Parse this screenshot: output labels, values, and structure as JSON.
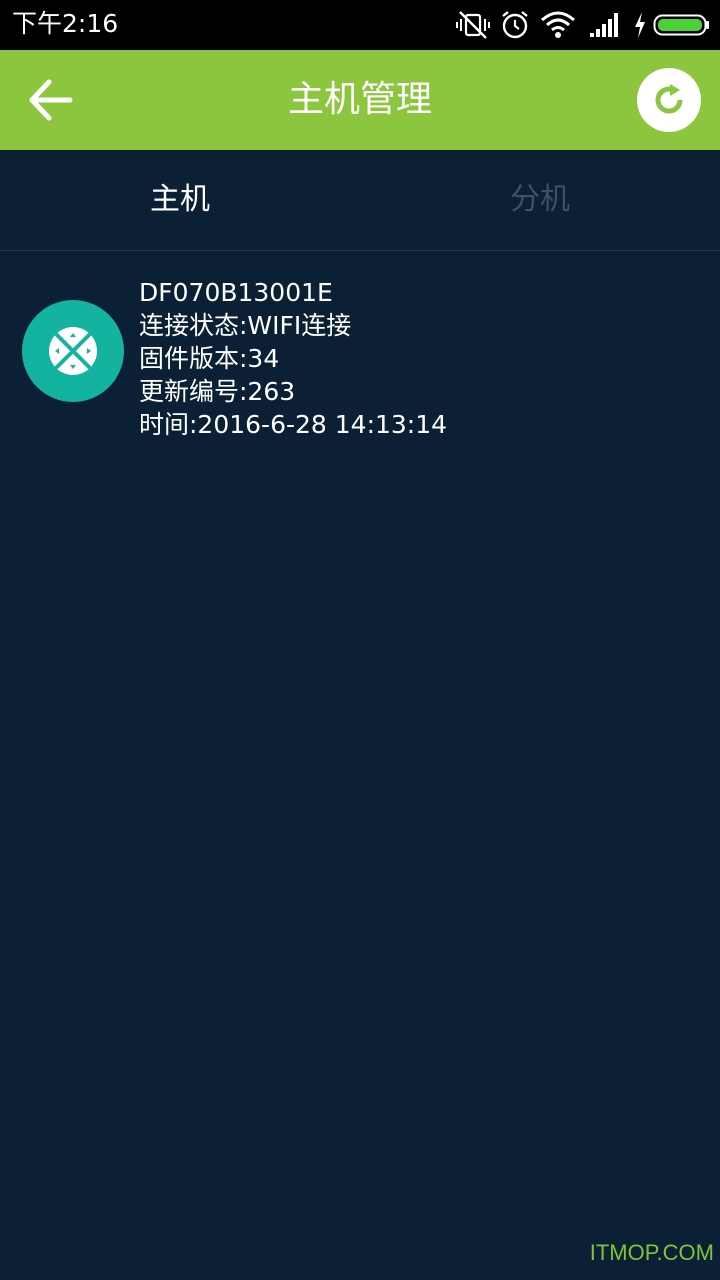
{
  "status_bar": {
    "time": "下午2:16",
    "icons": [
      "vibrate-off-icon",
      "alarm-icon",
      "wifi-icon",
      "signal-icon",
      "charging-icon",
      "battery-icon"
    ],
    "battery_color": "#4cd137"
  },
  "header": {
    "title": "主机管理",
    "back_icon": "arrow-left-icon",
    "refresh_icon": "refresh-icon",
    "background_color": "#8cc63f"
  },
  "tabs": [
    {
      "label": "主机",
      "active": true
    },
    {
      "label": "分机",
      "active": false
    }
  ],
  "devices": [
    {
      "icon": "remote-control-icon",
      "icon_color": "#14b3a0",
      "id": "DF070B13001E",
      "connection": "连接状态:WIFI连接",
      "firmware": "固件版本:34",
      "update_number": "更新编号:263",
      "time": "时间:2016-6-28 14:13:14"
    }
  ],
  "watermark": "ITMOP.COM",
  "colors": {
    "background": "#0b2035",
    "accent": "#8cc63f",
    "inactive_tab": "#3f5060"
  }
}
